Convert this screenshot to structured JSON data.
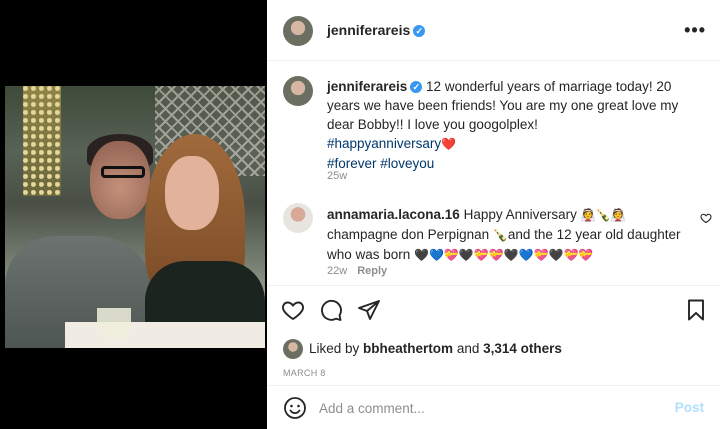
{
  "post": {
    "username": "jenniferareis",
    "verified_mark": "✓",
    "more_icon": "•••",
    "caption_text": " 12 wonderful years of marriage today! 20 years we have been friends! You are my one great love my dear Bobby!! I love you googolplex! ",
    "hashtags_line1": "#happyanniversary",
    "hashtags_line1_emoji": "❤️",
    "hashtags_line2": "#forever #loveyou",
    "caption_time": "25w"
  },
  "comment": {
    "username": "annamaria.lacona.16",
    "text_part1": " Happy Anniversary ",
    "emoji_part1": "👰🍾👰",
    "text_part2": " champagne don Perpignan ",
    "emoji_part2": "🍾",
    "text_part3": "and the 12 year old daughter who was born ",
    "emoji_part3": "🖤💙💝🖤💝💝🖤💙💝🖤💝💝",
    "time": "22w",
    "reply_label": "Reply"
  },
  "likes": {
    "prefix": "Liked by ",
    "liker": "bbheathertom",
    "middle": " and ",
    "count": "3,314 others"
  },
  "date": "MARCH 8",
  "add_comment": {
    "placeholder": "Add a comment...",
    "post_label": "Post"
  },
  "icons": {
    "like": "heart-icon",
    "comment": "comment-icon",
    "share": "paper-plane-icon",
    "save": "bookmark-icon",
    "emoji": "smiley-icon",
    "more": "more-horizontal-icon"
  },
  "colors": {
    "link": "#00376b",
    "verified": "#3897f0",
    "muted": "#8e8e8e",
    "post_disabled": "#b2dffc"
  }
}
